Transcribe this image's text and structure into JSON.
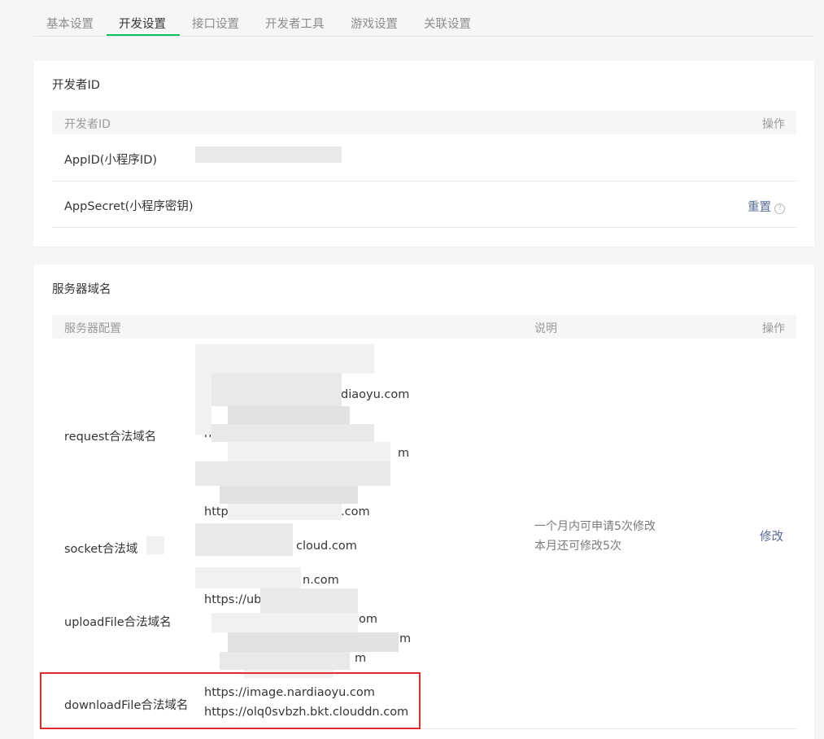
{
  "tabs": [
    {
      "label": "基本设置"
    },
    {
      "label": "开发设置"
    },
    {
      "label": "接口设置"
    },
    {
      "label": "开发者工具"
    },
    {
      "label": "游戏设置"
    },
    {
      "label": "关联设置"
    }
  ],
  "active_tab": "开发设置",
  "developer_id": {
    "title": "开发者ID",
    "header": {
      "col1": "开发者ID",
      "col2": "操作"
    },
    "rows": [
      {
        "label": "AppID(小程序ID)"
      },
      {
        "label": "AppSecret(小程序密钥)",
        "action": "重置"
      }
    ]
  },
  "server_domain": {
    "title": "服务器域名",
    "header": {
      "col1": "服务器配置",
      "col2": "说明",
      "col3": "操作"
    },
    "request": {
      "label": "request合法域名",
      "lines": [
        "diaoyu.com",
        "https:",
        "m",
        "http",
        ".com"
      ]
    },
    "socket": {
      "label": "socket合法域",
      "value": "cloud.com"
    },
    "upload": {
      "label": "uploadFile合法域名",
      "lines": [
        "n.com",
        "https://ubl",
        "om",
        "m",
        "m"
      ]
    },
    "download": {
      "label": "downloadFile合法域名",
      "lines": [
        "https://image.nardiaoyu.com",
        "https://olq0svbzh.bkt.clouddn.com"
      ]
    },
    "note_line1": "一个月内可申请5次修改",
    "note_line2": "本月还可修改5次",
    "action": "修改"
  },
  "colors": {
    "accent": "#07c160",
    "link": "#576b95",
    "highlight": "#e02b2b"
  }
}
